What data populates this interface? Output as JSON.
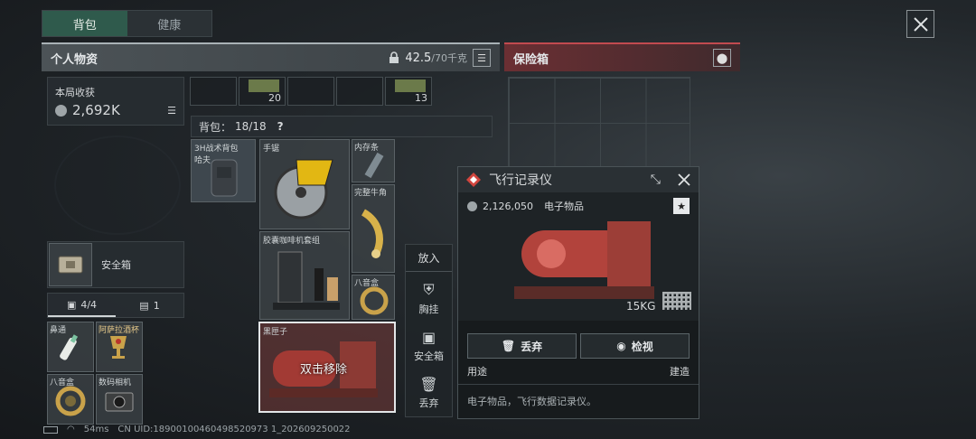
{
  "tabs": {
    "backpack": "背包",
    "health": "健康"
  },
  "personal": {
    "title": "个人物资",
    "weight_value": "42.5",
    "weight_max": "/70千克"
  },
  "safe": {
    "title": "保险箱"
  },
  "earnings": {
    "label": "本局收获",
    "value": "2,692K"
  },
  "safebox": {
    "label": "安全箱"
  },
  "pouch_tabs": {
    "items": "4/4",
    "count": "1"
  },
  "pouch_items": [
    "鼻通",
    "阿萨拉酒杯",
    "八音盒",
    "数码相机"
  ],
  "top_items": {
    "a_count": "20",
    "b_count": "13"
  },
  "backpack": {
    "label": "背包：",
    "value": "18/18",
    "help": "?"
  },
  "rig_item": "3H战术背包 哈夫",
  "items": {
    "saw": "手锯",
    "memory": "内存条",
    "horn": "完整牛角",
    "coffee": "胶囊咖啡机套组",
    "music_box": "八音盒",
    "black_box": "黑匣子",
    "double_click": "双击移除"
  },
  "side_menu": {
    "title": "放入",
    "chest": "胸挂",
    "safe": "安全箱",
    "discard": "丢弃"
  },
  "popup": {
    "title": "飞行记录仪",
    "price": "2,126,050",
    "category": "电子物品",
    "weight": "15KG",
    "discard": "丢弃",
    "inspect": "检视",
    "usage": "用途",
    "build": "建造",
    "desc": "电子物品，飞行数据记录仪。"
  },
  "footer": {
    "ping": "54ms",
    "uid": "CN UID:18900100460498520973 1_202609250022"
  }
}
